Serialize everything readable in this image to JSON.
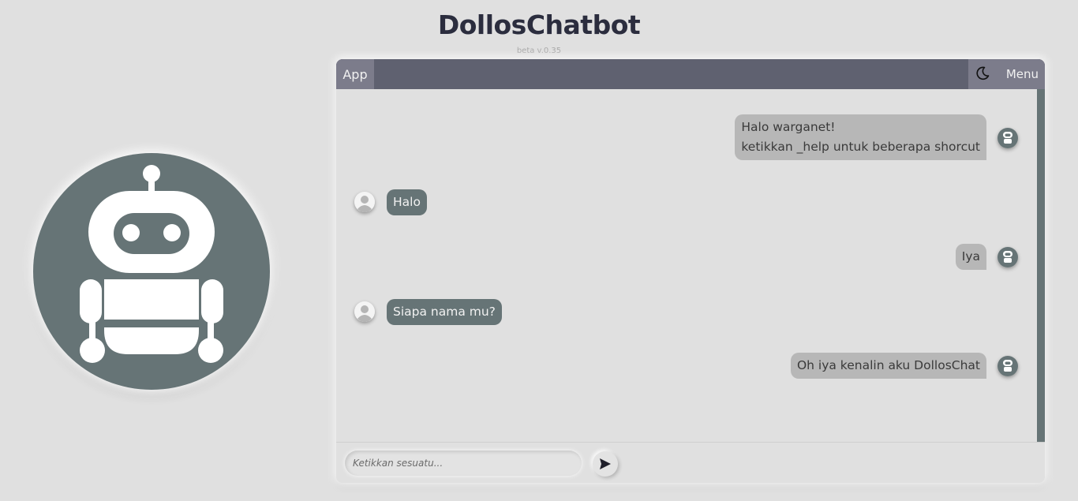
{
  "header": {
    "title": "DollosChatbot",
    "version": "beta v.0.35"
  },
  "topbar": {
    "app_label": "App",
    "menu_label": "Menu",
    "theme_icon": "moon-icon"
  },
  "messages": [
    {
      "sender": "bot",
      "lines": [
        "Halo warganet!",
        "ketikkan _help untuk beberapa shorcut"
      ]
    },
    {
      "sender": "user",
      "lines": [
        "Halo"
      ]
    },
    {
      "sender": "bot",
      "lines": [
        "Iya"
      ]
    },
    {
      "sender": "user",
      "lines": [
        "Siapa nama mu?"
      ]
    },
    {
      "sender": "bot",
      "lines": [
        "Oh iya kenalin aku DollosChat"
      ]
    }
  ],
  "input": {
    "placeholder": "Ketikkan sesuatu...",
    "value": ""
  },
  "icons": {
    "send": "send-icon",
    "bot_avatar": "robot-icon",
    "user_avatar": "user-icon"
  },
  "colors": {
    "accent": "#667476",
    "topbar": "#5f6170",
    "background": "#e0e0e0",
    "bot_bubble": "#b7b7b7"
  }
}
